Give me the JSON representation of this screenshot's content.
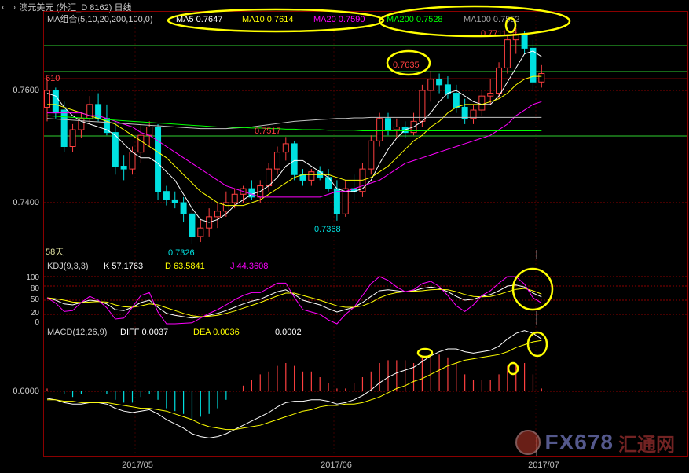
{
  "window": {
    "icon": "chart-window-icon",
    "title": "澳元美元 (外汇_D 8162) 日线"
  },
  "main": {
    "ma_label": "MA组合(5,10,20,200,100,0)",
    "ma5": "MA5 0.7647",
    "ma10": "MA10 0.7614",
    "ma20": "MA20 0.7590",
    "ma200": "MA200 0.7528",
    "ma100": "MA100 0.7552",
    "y_ticks": [
      "0.7600",
      "0.7400"
    ],
    "left_mark": "610",
    "days_label": "58天",
    "annotations": [
      "0.7711",
      "0.7635",
      "0.7517",
      "0.7368",
      "0.7326"
    ]
  },
  "kdj": {
    "label": "KDJ(9,3,3)",
    "k": "K  57.1763",
    "d": "D  63.5841",
    "j": "J  44.3608",
    "y_ticks": [
      "100",
      "80",
      "50",
      "20",
      "0"
    ]
  },
  "macd": {
    "label": "MACD(12,26,9)",
    "diff": "DIFF  0.0037",
    "dea": "DEA  0.0036",
    "macd_val": "0.0002",
    "y_tick": "0.0000"
  },
  "x_axis": [
    "2017/05",
    "2017/06",
    "2017/07"
  ],
  "watermark": {
    "text": "FX678",
    "sub": "汇通网"
  },
  "colors": {
    "up": "#ff4040",
    "down": "#00e0e0",
    "ma5": "#ffffff",
    "ma10": "#ffff00",
    "ma20": "#ff00ff",
    "ma200": "#00ff00",
    "ma100": "#c0c0c0",
    "grid": "#8b0000",
    "annot": "#ffff00"
  },
  "chart_data": {
    "type": "candlestick",
    "title": "澳元美元 (外汇_D 8162) 日线",
    "candles": [
      [
        0.757,
        0.762,
        0.7545,
        0.76
      ],
      [
        0.76,
        0.7605,
        0.755,
        0.756
      ],
      [
        0.7565,
        0.758,
        0.749,
        0.75
      ],
      [
        0.75,
        0.754,
        0.749,
        0.753
      ],
      [
        0.753,
        0.756,
        0.7515,
        0.755
      ],
      [
        0.755,
        0.759,
        0.754,
        0.7575
      ],
      [
        0.7575,
        0.7595,
        0.7545,
        0.755
      ],
      [
        0.755,
        0.7575,
        0.752,
        0.7525
      ],
      [
        0.7525,
        0.7545,
        0.745,
        0.7465
      ],
      [
        0.7465,
        0.7485,
        0.744,
        0.746
      ],
      [
        0.746,
        0.75,
        0.745,
        0.749
      ],
      [
        0.749,
        0.754,
        0.747,
        0.752
      ],
      [
        0.752,
        0.7545,
        0.75,
        0.7535
      ],
      [
        0.7535,
        0.754,
        0.7405,
        0.742
      ],
      [
        0.742,
        0.743,
        0.7395,
        0.7405
      ],
      [
        0.7405,
        0.742,
        0.739,
        0.74
      ],
      [
        0.74,
        0.741,
        0.7365,
        0.738
      ],
      [
        0.738,
        0.7395,
        0.7326,
        0.734
      ],
      [
        0.734,
        0.737,
        0.733,
        0.7355
      ],
      [
        0.7355,
        0.739,
        0.734,
        0.7375
      ],
      [
        0.7375,
        0.74,
        0.7355,
        0.7385
      ],
      [
        0.7385,
        0.742,
        0.7375,
        0.74
      ],
      [
        0.74,
        0.7425,
        0.739,
        0.7415
      ],
      [
        0.7415,
        0.743,
        0.74,
        0.7425
      ],
      [
        0.7425,
        0.744,
        0.7405,
        0.741
      ],
      [
        0.741,
        0.744,
        0.74,
        0.743
      ],
      [
        0.743,
        0.747,
        0.742,
        0.746
      ],
      [
        0.746,
        0.75,
        0.745,
        0.749
      ],
      [
        0.749,
        0.7517,
        0.7475,
        0.7505
      ],
      [
        0.7505,
        0.751,
        0.744,
        0.745
      ],
      [
        0.745,
        0.746,
        0.743,
        0.744
      ],
      [
        0.744,
        0.746,
        0.743,
        0.7455
      ],
      [
        0.7455,
        0.7465,
        0.744,
        0.7445
      ],
      [
        0.7445,
        0.746,
        0.742,
        0.7425
      ],
      [
        0.7425,
        0.744,
        0.7368,
        0.738
      ],
      [
        0.738,
        0.744,
        0.7375,
        0.7425
      ],
      [
        0.7425,
        0.745,
        0.7405,
        0.742
      ],
      [
        0.742,
        0.747,
        0.741,
        0.746
      ],
      [
        0.746,
        0.752,
        0.745,
        0.751
      ],
      [
        0.751,
        0.756,
        0.75,
        0.755
      ],
      [
        0.755,
        0.756,
        0.752,
        0.753
      ],
      [
        0.753,
        0.755,
        0.7515,
        0.7535
      ],
      [
        0.7535,
        0.7545,
        0.7515,
        0.7525
      ],
      [
        0.7525,
        0.756,
        0.752,
        0.7545
      ],
      [
        0.7545,
        0.761,
        0.7535,
        0.76
      ],
      [
        0.76,
        0.7635,
        0.758,
        0.762
      ],
      [
        0.762,
        0.763,
        0.7595,
        0.761
      ],
      [
        0.761,
        0.7625,
        0.7585,
        0.7595
      ],
      [
        0.7595,
        0.761,
        0.756,
        0.757
      ],
      [
        0.757,
        0.7585,
        0.754,
        0.755
      ],
      [
        0.755,
        0.7575,
        0.754,
        0.7565
      ],
      [
        0.7565,
        0.76,
        0.7555,
        0.759
      ],
      [
        0.759,
        0.762,
        0.7575,
        0.7595
      ],
      [
        0.7595,
        0.765,
        0.7585,
        0.764
      ],
      [
        0.764,
        0.77,
        0.763,
        0.769
      ],
      [
        0.769,
        0.7711,
        0.7665,
        0.77
      ],
      [
        0.77,
        0.7705,
        0.7665,
        0.7675
      ],
      [
        0.7675,
        0.769,
        0.76,
        0.7615
      ],
      [
        0.7615,
        0.7645,
        0.7605,
        0.763
      ]
    ],
    "ma": {
      "ma5": [
        0.7595,
        0.759,
        0.757,
        0.7555,
        0.7545,
        0.754,
        0.7535,
        0.753,
        0.752,
        0.7505,
        0.749,
        0.748,
        0.748,
        0.747,
        0.7455,
        0.744,
        0.7415,
        0.739,
        0.737,
        0.7365,
        0.737,
        0.738,
        0.7395,
        0.7405,
        0.7415,
        0.742,
        0.743,
        0.7445,
        0.7465,
        0.7475,
        0.7475,
        0.7465,
        0.7455,
        0.7445,
        0.7425,
        0.742,
        0.742,
        0.7425,
        0.744,
        0.747,
        0.7495,
        0.7515,
        0.753,
        0.7535,
        0.7545,
        0.756,
        0.758,
        0.7595,
        0.76,
        0.759,
        0.758,
        0.7575,
        0.7575,
        0.759,
        0.7615,
        0.764,
        0.7665,
        0.767,
        0.766
      ],
      "ma10": [
        0.7575,
        0.7575,
        0.757,
        0.7565,
        0.756,
        0.7555,
        0.755,
        0.7545,
        0.754,
        0.753,
        0.752,
        0.751,
        0.75,
        0.749,
        0.748,
        0.7465,
        0.745,
        0.7435,
        0.742,
        0.741,
        0.74,
        0.7395,
        0.7395,
        0.7395,
        0.74,
        0.7405,
        0.7415,
        0.7425,
        0.7435,
        0.7445,
        0.745,
        0.745,
        0.745,
        0.745,
        0.7445,
        0.744,
        0.744,
        0.744,
        0.7445,
        0.7455,
        0.7465,
        0.748,
        0.7495,
        0.751,
        0.752,
        0.7535,
        0.7545,
        0.756,
        0.757,
        0.7575,
        0.7575,
        0.7575,
        0.758,
        0.7585,
        0.7595,
        0.761,
        0.762,
        0.7625,
        0.7625
      ],
      "ma20": [
        0.756,
        0.756,
        0.756,
        0.756,
        0.756,
        0.7555,
        0.7555,
        0.755,
        0.7545,
        0.754,
        0.7535,
        0.7525,
        0.752,
        0.751,
        0.75,
        0.749,
        0.748,
        0.747,
        0.746,
        0.745,
        0.744,
        0.743,
        0.7425,
        0.742,
        0.7415,
        0.741,
        0.741,
        0.741,
        0.741,
        0.741,
        0.741,
        0.741,
        0.741,
        0.7415,
        0.742,
        0.742,
        0.7425,
        0.743,
        0.7435,
        0.744,
        0.745,
        0.746,
        0.747,
        0.7475,
        0.748,
        0.7485,
        0.749,
        0.7495,
        0.75,
        0.7505,
        0.751,
        0.7515,
        0.752,
        0.753,
        0.754,
        0.7555,
        0.7565,
        0.7575,
        0.758
      ],
      "ma100": [
        0.755,
        0.7549,
        0.7548,
        0.7547,
        0.7546,
        0.7545,
        0.7544,
        0.7543,
        0.7542,
        0.7541,
        0.754,
        0.7539,
        0.7538,
        0.7537,
        0.7536,
        0.7535,
        0.7534,
        0.7533,
        0.7532,
        0.7532,
        0.7532,
        0.7532,
        0.7533,
        0.7534,
        0.7535,
        0.7537,
        0.7539,
        0.7541,
        0.7543,
        0.7545,
        0.7546,
        0.7547,
        0.7548,
        0.7549,
        0.755,
        0.755,
        0.7551,
        0.7551,
        0.7552,
        0.7552,
        0.7552,
        0.7552,
        0.7552,
        0.7552,
        0.7552,
        0.7552,
        0.7552,
        0.7552,
        0.7552,
        0.7552,
        0.7552,
        0.7552,
        0.7552,
        0.7552,
        0.7552,
        0.7552,
        0.7552,
        0.7552,
        0.7552
      ],
      "ma200": [
        0.7555,
        0.7554,
        0.7553,
        0.7552,
        0.7551,
        0.755,
        0.7549,
        0.7548,
        0.7547,
        0.7546,
        0.7545,
        0.7544,
        0.7543,
        0.7542,
        0.7541,
        0.754,
        0.7539,
        0.7538,
        0.7537,
        0.7536,
        0.7535,
        0.7535,
        0.7534,
        0.7534,
        0.7533,
        0.7533,
        0.7532,
        0.7532,
        0.7531,
        0.7531,
        0.753,
        0.753,
        0.753,
        0.7529,
        0.7529,
        0.7529,
        0.7529,
        0.7528,
        0.7528,
        0.7528,
        0.7528,
        0.7528,
        0.7528,
        0.7528,
        0.7528,
        0.7528,
        0.7528,
        0.7528,
        0.7528,
        0.7528,
        0.7528,
        0.7528,
        0.7528,
        0.7528,
        0.7528,
        0.7528,
        0.7528,
        0.7528,
        0.7528
      ]
    },
    "kdj_values": {
      "k": [
        55,
        50,
        42,
        40,
        45,
        50,
        48,
        42,
        30,
        28,
        35,
        45,
        50,
        35,
        22,
        18,
        15,
        12,
        14,
        18,
        22,
        28,
        35,
        42,
        48,
        52,
        60,
        68,
        72,
        62,
        50,
        45,
        40,
        32,
        25,
        30,
        35,
        45,
        58,
        70,
        72,
        70,
        68,
        70,
        75,
        78,
        75,
        68,
        58,
        50,
        52,
        58,
        62,
        70,
        80,
        82,
        78,
        65,
        57
      ],
      "d": [
        55,
        53,
        50,
        46,
        45,
        46,
        47,
        46,
        40,
        36,
        35,
        38,
        42,
        40,
        34,
        28,
        22,
        17,
        15,
        16,
        18,
        22,
        27,
        33,
        39,
        45,
        52,
        59,
        65,
        65,
        60,
        55,
        50,
        44,
        38,
        35,
        35,
        38,
        45,
        55,
        62,
        66,
        68,
        69,
        70,
        72,
        73,
        72,
        68,
        62,
        58,
        57,
        58,
        62,
        68,
        73,
        75,
        70,
        63
      ],
      "j": [
        55,
        44,
        26,
        28,
        45,
        58,
        50,
        34,
        10,
        12,
        35,
        60,
        66,
        25,
        0,
        0,
        1,
        2,
        12,
        22,
        30,
        40,
        51,
        60,
        66,
        66,
        76,
        86,
        86,
        56,
        30,
        25,
        20,
        8,
        0,
        20,
        35,
        60,
        85,
        100,
        92,
        78,
        68,
        72,
        85,
        90,
        79,
        60,
        38,
        26,
        40,
        60,
        70,
        86,
        100,
        100,
        84,
        55,
        44
      ]
    },
    "macd_values": {
      "diff": [
        -0.0005,
        -0.0006,
        -0.0008,
        -0.0009,
        -0.0009,
        -0.0008,
        -0.0008,
        -0.0009,
        -0.0012,
        -0.0014,
        -0.0015,
        -0.0014,
        -0.0013,
        -0.0016,
        -0.002,
        -0.0023,
        -0.0026,
        -0.003,
        -0.0032,
        -0.0033,
        -0.0032,
        -0.003,
        -0.0027,
        -0.0024,
        -0.0021,
        -0.0018,
        -0.0015,
        -0.0011,
        -0.0008,
        -0.0007,
        -0.0007,
        -0.0006,
        -0.0006,
        -0.0007,
        -0.0009,
        -0.0008,
        -0.0006,
        -0.0003,
        0.0001,
        0.0006,
        0.001,
        0.0013,
        0.0015,
        0.0017,
        0.0021,
        0.0025,
        0.0028,
        0.003,
        0.003,
        0.0028,
        0.0027,
        0.0028,
        0.0029,
        0.0032,
        0.0037,
        0.0041,
        0.0043,
        0.0041,
        0.0037
      ],
      "dea": [
        -0.0006,
        -0.0006,
        -0.0007,
        -0.0007,
        -0.0008,
        -0.0008,
        -0.0008,
        -0.0008,
        -0.0009,
        -0.001,
        -0.0011,
        -0.0012,
        -0.0012,
        -0.0013,
        -0.0014,
        -0.0016,
        -0.0018,
        -0.002,
        -0.0023,
        -0.0025,
        -0.0026,
        -0.0027,
        -0.0027,
        -0.0026,
        -0.0025,
        -0.0024,
        -0.0022,
        -0.002,
        -0.0018,
        -0.0016,
        -0.0014,
        -0.0013,
        -0.0011,
        -0.001,
        -0.001,
        -0.0009,
        -0.0009,
        -0.0008,
        -0.0006,
        -0.0004,
        -0.0001,
        0.0002,
        0.0004,
        0.0007,
        0.0009,
        0.0012,
        0.0015,
        0.0018,
        0.002,
        0.0022,
        0.0023,
        0.0024,
        0.0025,
        0.0026,
        0.0028,
        0.0031,
        0.0033,
        0.0035,
        0.0036
      ],
      "macd": [
        0.0002,
        0.0,
        -0.0002,
        -0.0004,
        -0.0002,
        0.0,
        0.0,
        -0.0002,
        -0.0006,
        -0.0008,
        -0.0008,
        -0.0004,
        -0.0002,
        -0.0006,
        -0.0012,
        -0.0014,
        -0.0016,
        -0.002,
        -0.0018,
        -0.0016,
        -0.0012,
        -0.0006,
        0.0,
        0.0004,
        0.0008,
        0.0012,
        0.0014,
        0.0018,
        0.002,
        0.0018,
        0.0014,
        0.0014,
        0.001,
        0.0006,
        0.0002,
        0.0002,
        0.0006,
        0.001,
        0.0014,
        0.002,
        0.0022,
        0.0022,
        0.0022,
        0.002,
        0.0024,
        0.0026,
        0.0026,
        0.0024,
        0.002,
        0.0012,
        0.0008,
        0.0008,
        0.0008,
        0.0012,
        0.0018,
        0.002,
        0.002,
        0.0012,
        0.0002
      ]
    }
  }
}
